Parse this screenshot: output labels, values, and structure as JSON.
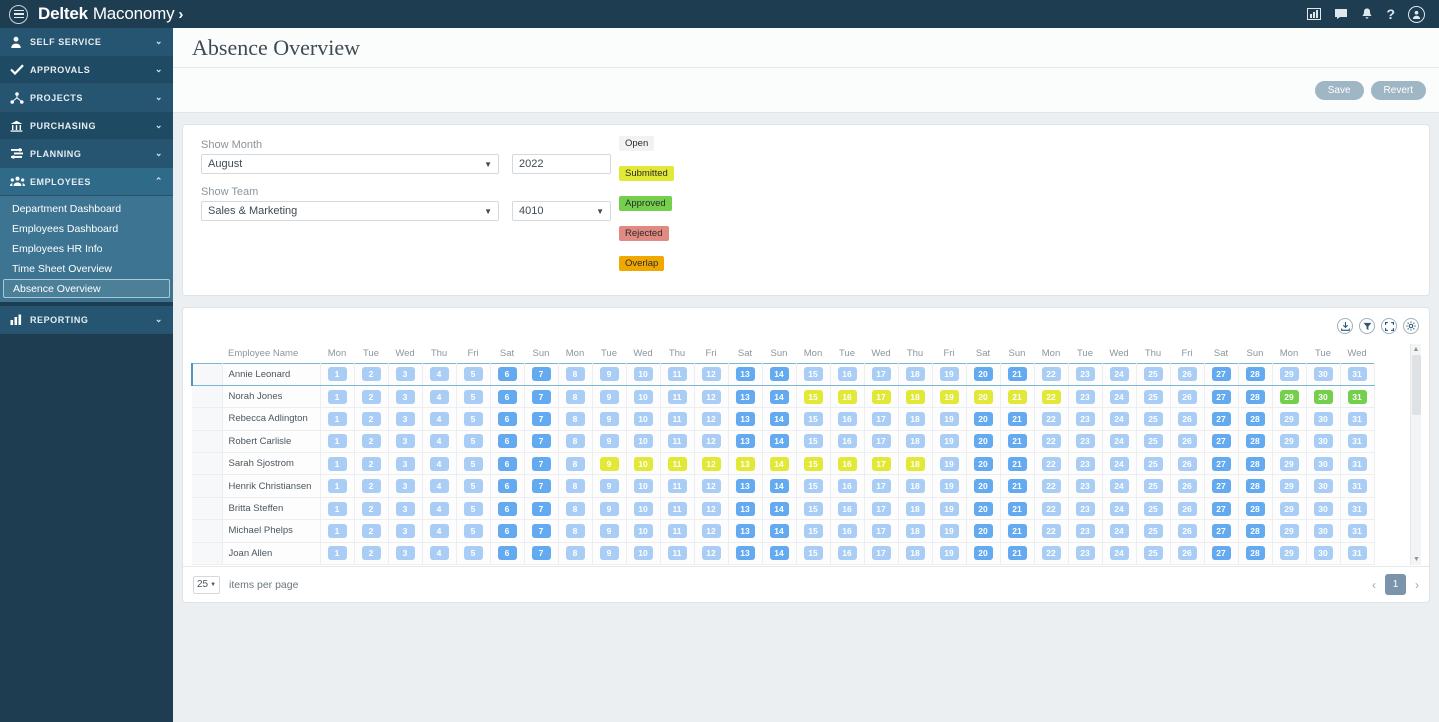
{
  "topbar": {
    "menu_icon": "hamburger-icon",
    "brand_bold": "Deltek",
    "brand_light": "Maconomy",
    "brand_chevron": "›",
    "icons": [
      {
        "name": "reports-icon",
        "glyph": "📊"
      },
      {
        "name": "chat-icon",
        "glyph": "💬"
      },
      {
        "name": "notifications-icon",
        "glyph": "🔔"
      },
      {
        "name": "help-icon",
        "glyph": "?"
      },
      {
        "name": "user-avatar-icon",
        "glyph": "👤"
      }
    ]
  },
  "sidebar": {
    "items": [
      {
        "label": "SELF SERVICE",
        "icon": "person-icon",
        "glyph": "👤",
        "chevron": "⌄",
        "expanded": false
      },
      {
        "label": "APPROVALS",
        "icon": "check-icon",
        "glyph": "✔",
        "chevron": "⌄",
        "expanded": false
      },
      {
        "label": "PROJECTS",
        "icon": "hierarchy-icon",
        "glyph": "⛓",
        "chevron": "⌄",
        "expanded": false
      },
      {
        "label": "PURCHASING",
        "icon": "bank-icon",
        "glyph": "🏦",
        "chevron": "⌄",
        "expanded": false
      },
      {
        "label": "PLANNING",
        "icon": "sliders-icon",
        "glyph": "☰",
        "chevron": "⌄",
        "expanded": false
      },
      {
        "label": "EMPLOYEES",
        "icon": "people-icon",
        "glyph": "👥",
        "chevron": "⌃",
        "expanded": true
      },
      {
        "label": "REPORTING",
        "icon": "bar-chart-icon",
        "glyph": "📊",
        "chevron": "⌄",
        "expanded": false
      }
    ],
    "employees_submenu": [
      {
        "label": "Department Dashboard",
        "selected": false
      },
      {
        "label": "Employees Dashboard",
        "selected": false
      },
      {
        "label": "Employees HR Info",
        "selected": false
      },
      {
        "label": "Time Sheet Overview",
        "selected": false
      },
      {
        "label": "Absence Overview",
        "selected": true
      }
    ]
  },
  "page": {
    "title": "Absence Overview",
    "save_label": "Save",
    "revert_label": "Revert"
  },
  "filters": {
    "show_month_label": "Show Month",
    "month_value": "August",
    "year_value": "2022",
    "show_team_label": "Show Team",
    "team_value": "Sales & Marketing",
    "team_code_value": "4010",
    "caret": "▼"
  },
  "legend": [
    {
      "label": "Open",
      "color": "#f2f2f2"
    },
    {
      "label": "Submitted",
      "color": "#e2e836"
    },
    {
      "label": "Approved",
      "color": "#74d04c"
    },
    {
      "label": "Rejected",
      "color": "#e08a81"
    },
    {
      "label": "Overlap",
      "color": "#f0a800"
    }
  ],
  "table_tools": [
    {
      "name": "download-icon",
      "glyph": "⤓"
    },
    {
      "name": "filter-icon",
      "glyph": "▼"
    },
    {
      "name": "fullscreen-icon",
      "glyph": "⛶"
    },
    {
      "name": "settings-gear-icon",
      "glyph": "⚙"
    }
  ],
  "footer": {
    "items_per_page_value": "25",
    "items_per_page_label": "items per page",
    "prev_glyph": "‹",
    "next_glyph": "›",
    "current_page": "1"
  },
  "grid": {
    "name_header": "Employee Name",
    "weekday_names": [
      "Mon",
      "Tue",
      "Wed",
      "Thu",
      "Fri",
      "Sat",
      "Sun"
    ],
    "days": [
      1,
      2,
      3,
      4,
      5,
      6,
      7,
      8,
      9,
      10,
      11,
      12,
      13,
      14,
      15,
      16,
      17,
      18,
      19,
      20,
      21,
      22,
      23,
      24,
      25,
      26,
      27,
      28,
      29,
      30,
      31
    ],
    "day_weekdays": [
      "Mon",
      "Tue",
      "Wed",
      "Thu",
      "Fri",
      "Sat",
      "Sun",
      "Mon",
      "Tue",
      "Wed",
      "Thu",
      "Fri",
      "Sat",
      "Sun",
      "Mon",
      "Tue",
      "Wed",
      "Thu",
      "Fri",
      "Sat",
      "Sun",
      "Mon",
      "Tue",
      "Wed",
      "Thu",
      "Fri",
      "Sat",
      "Sun",
      "Mon",
      "Tue",
      "Wed"
    ],
    "rows": [
      {
        "name": "Annie Leonard",
        "active": true,
        "states": [
          "weekday",
          "weekday",
          "weekday",
          "weekday",
          "weekday",
          "weekend",
          "weekend",
          "weekday",
          "weekday",
          "weekday",
          "weekday",
          "weekday",
          "weekend",
          "weekend",
          "weekday",
          "weekday",
          "weekday",
          "weekday",
          "weekday",
          "weekend",
          "weekend",
          "weekday",
          "weekday",
          "weekday",
          "weekday",
          "weekday",
          "weekend",
          "weekend",
          "weekday",
          "weekday",
          "weekday"
        ]
      },
      {
        "name": "Norah Jones",
        "active": false,
        "states": [
          "weekday",
          "weekday",
          "weekday",
          "weekday",
          "weekday",
          "weekend",
          "weekend",
          "weekday",
          "weekday",
          "weekday",
          "weekday",
          "weekday",
          "weekend",
          "weekend",
          "submitted",
          "submitted",
          "submitted",
          "submitted",
          "submitted",
          "submitted",
          "submitted",
          "submitted",
          "weekday",
          "weekday",
          "weekday",
          "weekday",
          "weekend",
          "weekend",
          "approved",
          "approved",
          "approved"
        ]
      },
      {
        "name": "Rebecca Adlington",
        "active": false,
        "states": [
          "weekday",
          "weekday",
          "weekday",
          "weekday",
          "weekday",
          "weekend",
          "weekend",
          "weekday",
          "weekday",
          "weekday",
          "weekday",
          "weekday",
          "weekend",
          "weekend",
          "weekday",
          "weekday",
          "weekday",
          "weekday",
          "weekday",
          "weekend",
          "weekend",
          "weekday",
          "weekday",
          "weekday",
          "weekday",
          "weekday",
          "weekend",
          "weekend",
          "weekday",
          "weekday",
          "weekday"
        ]
      },
      {
        "name": "Robert Carlisle",
        "active": false,
        "states": [
          "weekday",
          "weekday",
          "weekday",
          "weekday",
          "weekday",
          "weekend",
          "weekend",
          "weekday",
          "weekday",
          "weekday",
          "weekday",
          "weekday",
          "weekend",
          "weekend",
          "weekday",
          "weekday",
          "weekday",
          "weekday",
          "weekday",
          "weekend",
          "weekend",
          "weekday",
          "weekday",
          "weekday",
          "weekday",
          "weekday",
          "weekend",
          "weekend",
          "weekday",
          "weekday",
          "weekday"
        ]
      },
      {
        "name": "Sarah Sjostrom",
        "active": false,
        "states": [
          "weekday",
          "weekday",
          "weekday",
          "weekday",
          "weekday",
          "weekend",
          "weekend",
          "weekday",
          "submitted",
          "submitted",
          "submitted",
          "submitted",
          "submitted",
          "submitted",
          "submitted",
          "submitted",
          "submitted",
          "submitted",
          "weekday",
          "weekend",
          "weekend",
          "weekday",
          "weekday",
          "weekday",
          "weekday",
          "weekday",
          "weekend",
          "weekend",
          "weekday",
          "weekday",
          "weekday"
        ]
      },
      {
        "name": "Henrik Christiansen",
        "active": false,
        "states": [
          "weekday",
          "weekday",
          "weekday",
          "weekday",
          "weekday",
          "weekend",
          "weekend",
          "weekday",
          "weekday",
          "weekday",
          "weekday",
          "weekday",
          "weekend",
          "weekend",
          "weekday",
          "weekday",
          "weekday",
          "weekday",
          "weekday",
          "weekend",
          "weekend",
          "weekday",
          "weekday",
          "weekday",
          "weekday",
          "weekday",
          "weekend",
          "weekend",
          "weekday",
          "weekday",
          "weekday"
        ]
      },
      {
        "name": "Britta Steffen",
        "active": false,
        "states": [
          "weekday",
          "weekday",
          "weekday",
          "weekday",
          "weekday",
          "weekend",
          "weekend",
          "weekday",
          "weekday",
          "weekday",
          "weekday",
          "weekday",
          "weekend",
          "weekend",
          "weekday",
          "weekday",
          "weekday",
          "weekday",
          "weekday",
          "weekend",
          "weekend",
          "weekday",
          "weekday",
          "weekday",
          "weekday",
          "weekday",
          "weekend",
          "weekend",
          "weekday",
          "weekday",
          "weekday"
        ]
      },
      {
        "name": "Michael Phelps",
        "active": false,
        "states": [
          "weekday",
          "weekday",
          "weekday",
          "weekday",
          "weekday",
          "weekend",
          "weekend",
          "weekday",
          "weekday",
          "weekday",
          "weekday",
          "weekday",
          "weekend",
          "weekend",
          "weekday",
          "weekday",
          "weekday",
          "weekday",
          "weekday",
          "weekend",
          "weekend",
          "weekday",
          "weekday",
          "weekday",
          "weekday",
          "weekday",
          "weekend",
          "weekend",
          "weekday",
          "weekday",
          "weekday"
        ]
      },
      {
        "name": "Joan Allen",
        "active": false,
        "states": [
          "weekday",
          "weekday",
          "weekday",
          "weekday",
          "weekday",
          "weekend",
          "weekend",
          "weekday",
          "weekday",
          "weekday",
          "weekday",
          "weekday",
          "weekend",
          "weekend",
          "weekday",
          "weekday",
          "weekday",
          "weekday",
          "weekday",
          "weekend",
          "weekend",
          "weekday",
          "weekday",
          "weekday",
          "weekday",
          "weekday",
          "weekend",
          "weekend",
          "weekday",
          "weekday",
          "weekday"
        ]
      }
    ]
  }
}
